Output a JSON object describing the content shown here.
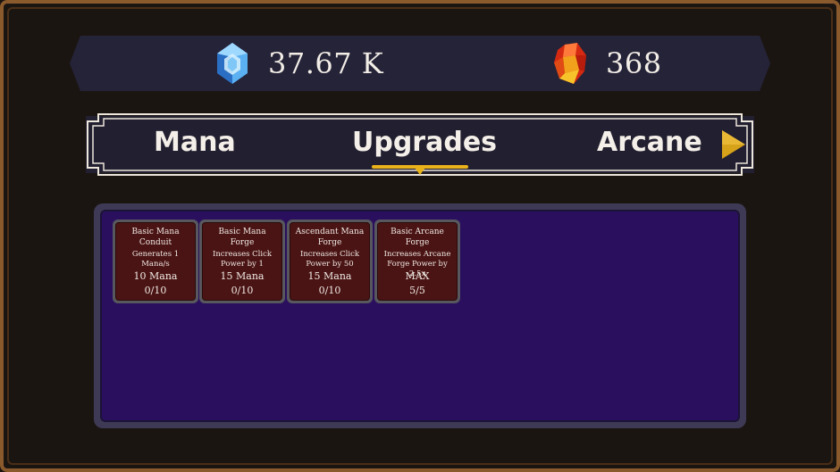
{
  "resources": {
    "mana": {
      "value": "37.67 K",
      "icon": "blue-crystal-icon"
    },
    "ruby": {
      "value": "368",
      "icon": "red-gem-icon"
    }
  },
  "tabs": {
    "items": [
      {
        "label": "Mana"
      },
      {
        "label": "Upgrades"
      },
      {
        "label": "Arcane"
      }
    ],
    "active": "Upgrades",
    "next_icon": "play-arrow-icon"
  },
  "upgrades": [
    {
      "title": "Basic Mana Conduit",
      "desc": "Generates 1 Mana/s",
      "cost": "10 Mana",
      "count": "0/10"
    },
    {
      "title": "Basic Mana Forge",
      "desc": "Increases Click Power by 1",
      "cost": "15 Mana",
      "count": "0/10"
    },
    {
      "title": "Ascendant Mana Forge",
      "desc": "Increases Click Power by 50",
      "cost": "15 Mana",
      "count": "0/10"
    },
    {
      "title": "Basic Arcane Forge",
      "desc": "Increases Arcane Forge Power by 2.5x",
      "cost": "MAX",
      "count": "5/5"
    }
  ],
  "colors": {
    "accent_gold": "#e8b21a",
    "panel_purple": "#2a0f5e",
    "card_red": "#4a1414"
  }
}
